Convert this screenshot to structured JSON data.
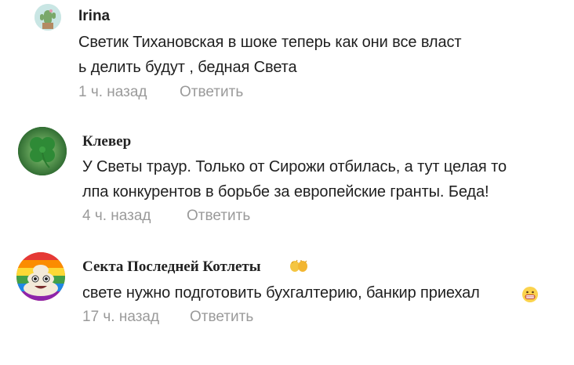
{
  "comments": [
    {
      "author": "Irina",
      "avatar_icon": "cactus-avatar-icon",
      "lines": [
        "Светик Тихановская в шоке теперь как они все власт",
        "ь делить будут , бедная Света"
      ],
      "time": "1 ч. назад",
      "reply_label": "Ответить"
    },
    {
      "author": "Клевер",
      "avatar_icon": "clover-avatar-icon",
      "lines": [
        "У Светы траур. Только от Сирожи отбилась, а тут целая то",
        "лпа конкурентов в борьбе за европейские гранты. Беда!"
      ],
      "time": "4 ч. назад",
      "reply_label": "Ответить"
    },
    {
      "author": "Секта Последней Котлеты",
      "avatar_icon": "poop-emoji-avatar-icon",
      "author_badge_icon": "clapping-hands-icon",
      "lines": [
        "свете нужно подготовить бухгалтерию, банкир приехал"
      ],
      "trailing_icon": "grinning-face-icon",
      "time": "17 ч. назад",
      "reply_label": "Ответить"
    }
  ],
  "colors": {
    "text": "#1f1f1f",
    "meta": "#9a9a9a",
    "background": "#ffffff"
  }
}
